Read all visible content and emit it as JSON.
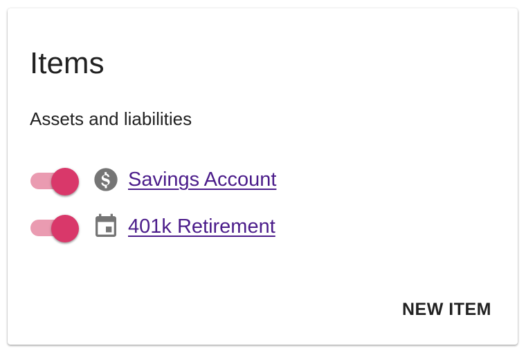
{
  "card": {
    "title": "Items",
    "subtitle": "Assets and liabilities"
  },
  "items": [
    {
      "label": "Savings Account",
      "icon": "dollar-circle-icon",
      "toggle_on": true
    },
    {
      "label": "401k Retirement",
      "icon": "calendar-icon",
      "toggle_on": true
    }
  ],
  "actions": {
    "new_item_label": "NEW ITEM"
  },
  "colors": {
    "toggle_thumb": "#d9386a",
    "toggle_track": "#ea9bb1",
    "link": "#4b1c8a",
    "icon": "#757575",
    "text": "#212121"
  }
}
